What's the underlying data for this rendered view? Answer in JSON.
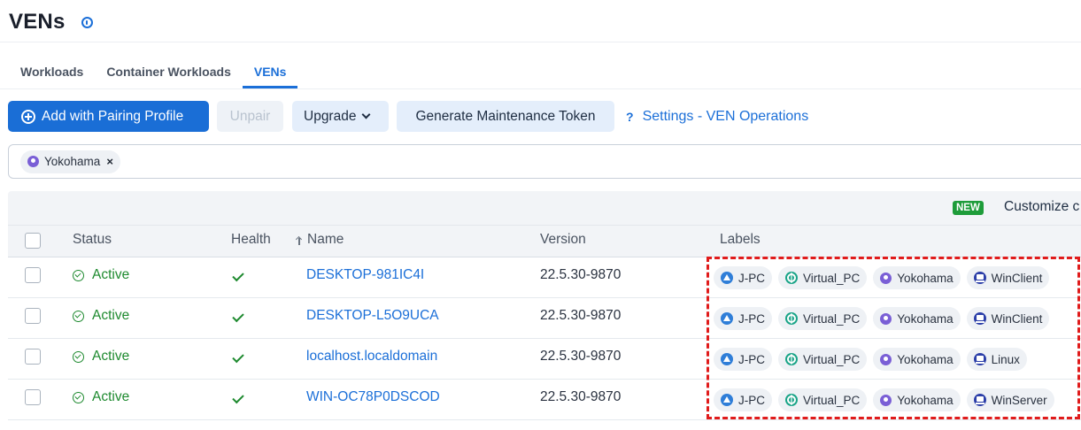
{
  "page": {
    "title": "VENs"
  },
  "tabs": [
    {
      "label": "Workloads"
    },
    {
      "label": "Container Workloads"
    },
    {
      "label": "VENs",
      "active": true
    }
  ],
  "toolbar": {
    "add_label": "Add with Pairing Profile",
    "unpair_label": "Unpair",
    "upgrade_label": "Upgrade",
    "token_label": "Generate Maintenance Token",
    "help_icon_text": "?",
    "settings_label": "Settings - VEN Operations"
  },
  "filter": {
    "chip_label": "Yokohama",
    "chip_close": "×"
  },
  "grid": {
    "new_badge": "NEW",
    "customize_label": "Customize c",
    "columns": {
      "status": "Status",
      "health": "Health",
      "name": "Name",
      "version": "Version",
      "labels": "Labels"
    },
    "rows": [
      {
        "status": "Active",
        "name": "DESKTOP-981IC4I",
        "version": "22.5.30-9870",
        "labels": {
          "app": "J-PC",
          "env": "Virtual_PC",
          "loc": "Yokohama",
          "role": "WinClient"
        }
      },
      {
        "status": "Active",
        "name": "DESKTOP-L5O9UCA",
        "version": "22.5.30-9870",
        "labels": {
          "app": "J-PC",
          "env": "Virtual_PC",
          "loc": "Yokohama",
          "role": "WinClient"
        }
      },
      {
        "status": "Active",
        "name": "localhost.localdomain",
        "version": "22.5.30-9870",
        "labels": {
          "app": "J-PC",
          "env": "Virtual_PC",
          "loc": "Yokohama",
          "role": "Linux"
        }
      },
      {
        "status": "Active",
        "name": "WIN-OC78P0DSCOD",
        "version": "22.5.30-9870",
        "labels": {
          "app": "J-PC",
          "env": "Virtual_PC",
          "loc": "Yokohama",
          "role": "WinServer"
        }
      }
    ]
  },
  "colors": {
    "primary": "#1a6ed6",
    "link": "#1b6fd8",
    "active_status": "#1e8a2f",
    "new_badge": "#1e9c3a",
    "highlight": "#e01b1b"
  },
  "icons": {
    "info": "info-icon",
    "add": "plus-circle-icon",
    "upgrade": "chevron-down-icon",
    "location": "location-pin-icon",
    "status": "check-circle-icon",
    "health": "checkmark-icon",
    "sort": "sort-arrow-icon",
    "app_label": "application-label-icon",
    "env_label": "environment-label-icon",
    "role_label": "role-label-icon"
  }
}
